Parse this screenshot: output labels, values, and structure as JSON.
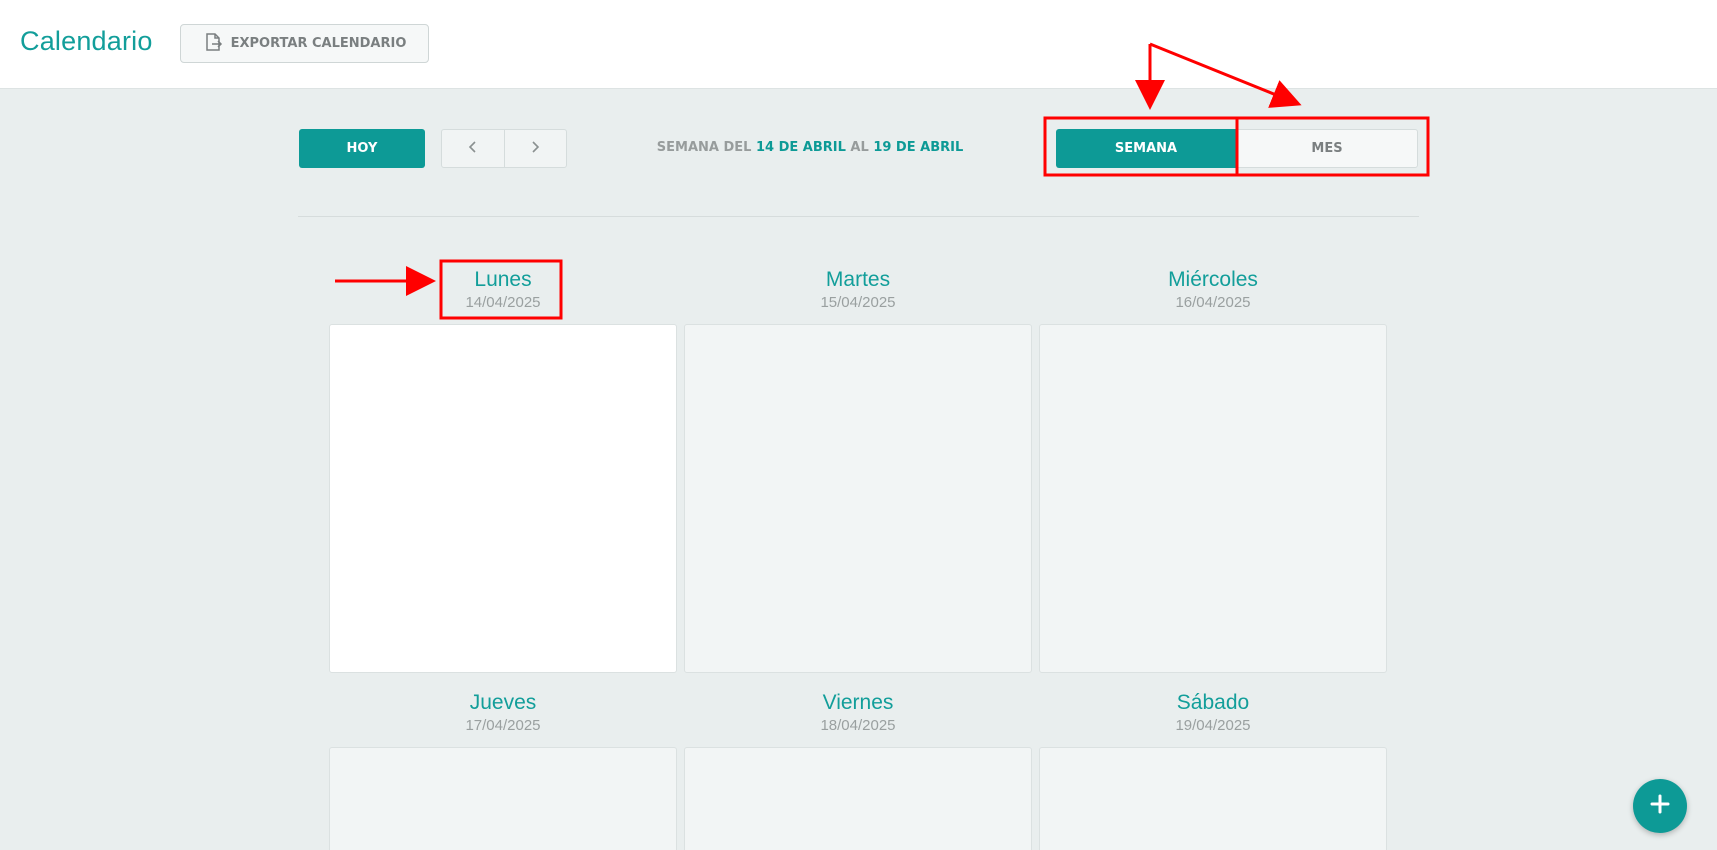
{
  "header": {
    "title": "Calendario",
    "export_label": "EXPORTAR CALENDARIO"
  },
  "toolbar": {
    "today_label": "HOY",
    "week_range": {
      "prefix": "SEMANA DEL",
      "start": "14 DE ABRIL",
      "mid": "AL",
      "end": "19 DE ABRIL"
    },
    "views": [
      {
        "label": "SEMANA",
        "active": true
      },
      {
        "label": "MES",
        "active": false
      }
    ]
  },
  "days": [
    {
      "name": "Lunes",
      "date": "14/04/2025",
      "today": true
    },
    {
      "name": "Martes",
      "date": "15/04/2025",
      "today": false
    },
    {
      "name": "Miércoles",
      "date": "16/04/2025",
      "today": false
    },
    {
      "name": "Jueves",
      "date": "17/04/2025",
      "today": false
    },
    {
      "name": "Viernes",
      "date": "18/04/2025",
      "today": false
    },
    {
      "name": "Sábado",
      "date": "19/04/2025",
      "today": false
    }
  ],
  "icons": {
    "export": "file-export-icon",
    "prev": "chevron-left-icon",
    "next": "chevron-right-icon",
    "add": "plus-icon"
  },
  "colors": {
    "accent": "#0d9a96",
    "annotation": "#ff0000"
  }
}
